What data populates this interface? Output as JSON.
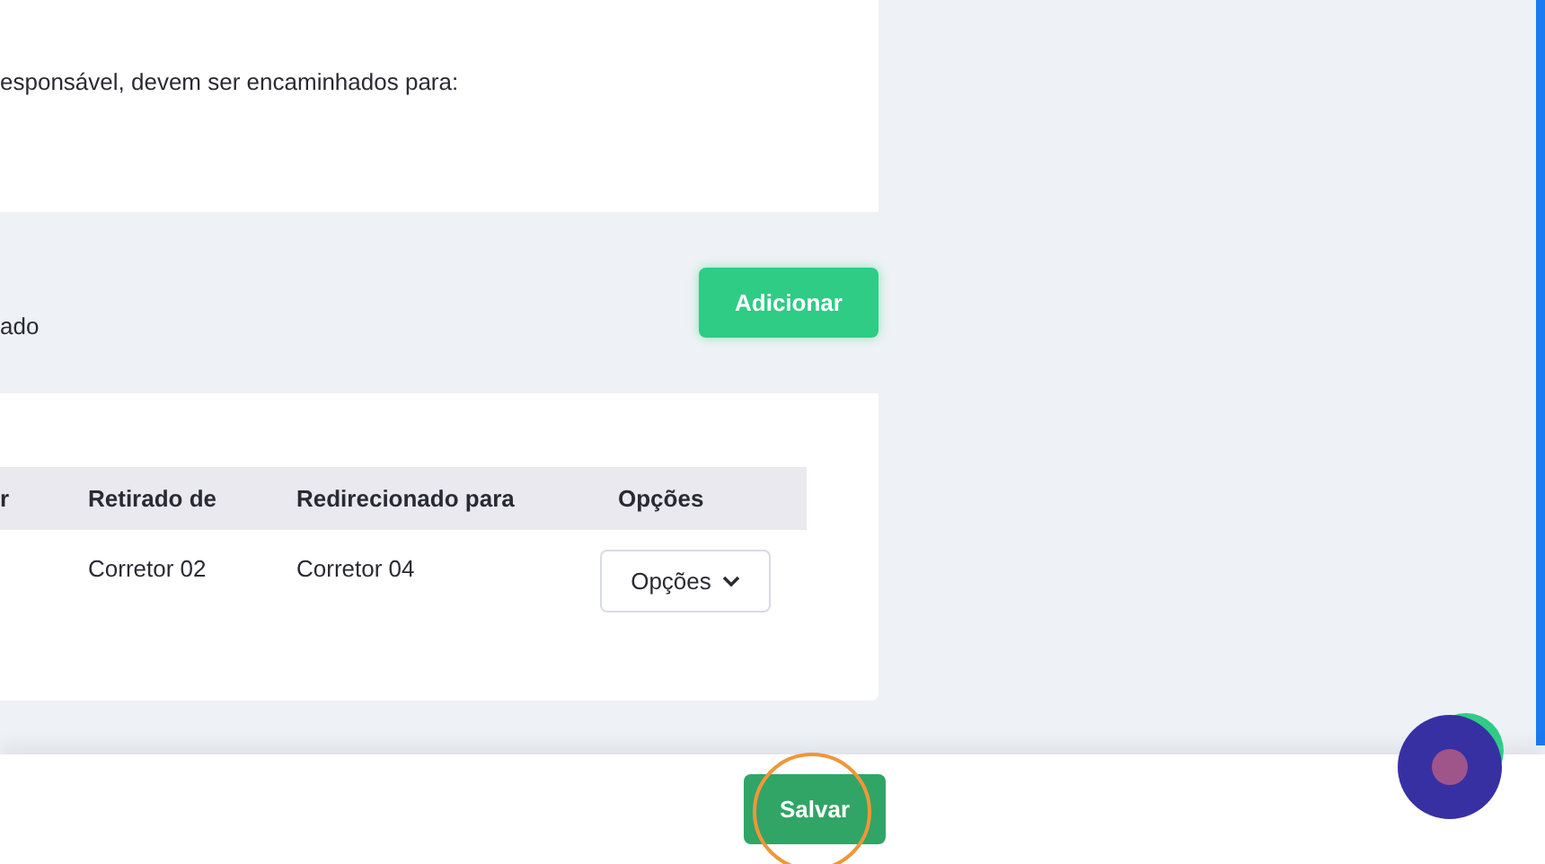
{
  "instruction_card": {
    "text": "esponsável, devem ser encaminhados para:"
  },
  "add_section": {
    "label": "ado",
    "button": "Adicionar"
  },
  "table": {
    "columns": [
      "r",
      "Retirado de",
      "Redirecionado para",
      "Opções"
    ],
    "rows": [
      {
        "cells": [
          "",
          "Corretor 02",
          "Corretor 04"
        ],
        "options": "Opções"
      }
    ]
  },
  "footer": {
    "button": "Salvar",
    "highlighted": true
  }
}
